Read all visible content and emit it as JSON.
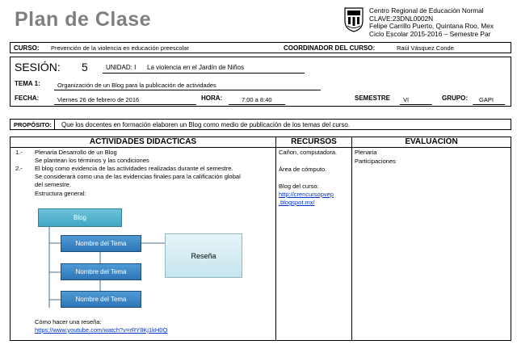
{
  "header": {
    "title": "Plan de Clase",
    "institution": [
      "Centro Regional de Educación Normal",
      "CLAVE:23DNL0002N",
      "Felipe Carrillo Puerto, Quintana Roo, Mex",
      "Ciclo Escolar 2015-2016 – Semestre Par"
    ]
  },
  "curso_row": {
    "curso_label": "CURSO:",
    "curso_value": "Prevención de la violencia en educación preescolar",
    "coord_label": "COORDINADOR DEL CURSO:",
    "coord_value": "Raúl Vásquez Conde"
  },
  "session": {
    "sesion_label": "SESIÓN:",
    "sesion_value": "5",
    "unidad_label": "UNIDAD: I",
    "unidad_value": "La violencia en el Jardín de Niños",
    "tema_label": "TEMA 1:",
    "tema_value": "Organización de un Blog para la publicación de actividades",
    "fecha_label": "FECHA:",
    "fecha_value": "Viernes 26 de febrero de 2016",
    "hora_label": "HORA:",
    "hora_value": "7:00 a 8:40",
    "semestre_label": "SEMESTRE",
    "semestre_value": "VI",
    "grupo_label": "GRUPO:",
    "grupo_value": "GAPI"
  },
  "proposito": {
    "label": "PROPÓSITO:",
    "value": "Que los docentes en formación elaboren un Blog como medio de publicación de los temas del curso."
  },
  "table": {
    "headers": [
      "ACTIVIDADES DIDÁCTICAS",
      "RECURSOS",
      "EVALUACIÓN"
    ],
    "activities": {
      "item1_num": "1.-",
      "item1_line1": "Plenaria Desarrollo de un Blog",
      "item1_line2": "Se plantean los términos y las condiciones",
      "item2_num": "2.-",
      "item2_line1": "El blog como evidencia de las actividades realizadas durante el semestre.",
      "item2_line2": "Se considerará como una de las evidencias finales para la calificación global",
      "item2_line3": "del semestre.",
      "item2_line4": "Estructura general:",
      "review_label": "Cómo hacer una reseña:",
      "review_link": "https://www.youtube.com/watch?v=rRY8Kj1kH0Q"
    },
    "diagram": {
      "root": "Blog",
      "nodes": [
        "Nombre del Tema",
        "Nombre del Tema",
        "Nombre del Tema"
      ],
      "side": "Reseña"
    },
    "recursos": {
      "line1": "Cañon, computadora.",
      "line2": "Área de cómputo.",
      "line3": "Blog del curso:",
      "link1": "http://crencursopvep",
      "link2": ".blogspot.mx/"
    },
    "evaluacion": [
      "Plenaria",
      "Participaciones"
    ]
  }
}
